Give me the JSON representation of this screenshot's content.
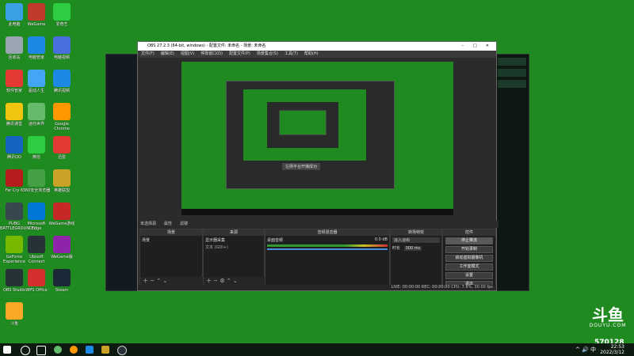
{
  "colors": {
    "desktop_bg": "#1f8a1f",
    "obs_bg": "#2b2b2b",
    "dock_bg": "#1f1f1f"
  },
  "desktop_icons": [
    {
      "label": "此电脑",
      "icon": "computer-icon",
      "color": "#3aa0e6"
    },
    {
      "label": "WeGame",
      "icon": "wegame-icon",
      "color": "#c0392b"
    },
    {
      "label": "爱奇艺",
      "icon": "iqiyi-icon",
      "color": "#2ecc40"
    },
    {
      "label": "回收站",
      "icon": "recycle-bin-icon",
      "color": "#9aa5b1"
    },
    {
      "label": "电脑管家",
      "icon": "pc-manager-icon",
      "color": "#1e88e5"
    },
    {
      "label": "电脑视频",
      "icon": "video-icon",
      "color": "#4a6fdc"
    },
    {
      "label": "软件管家",
      "icon": "software-manager-icon",
      "color": "#e53935"
    },
    {
      "label": "驱动人生",
      "icon": "driver-icon",
      "color": "#42a5f5"
    },
    {
      "label": "腾讯视频",
      "icon": "tencent-video-icon",
      "color": "#1e88e5"
    },
    {
      "label": "腾讯课堂",
      "icon": "notes-icon",
      "color": "#f1c40f"
    },
    {
      "label": "迷你世界",
      "icon": "game-icon",
      "color": "#66bb6a"
    },
    {
      "label": "Google Chrome",
      "icon": "chrome-icon",
      "color": "#ff9800"
    },
    {
      "label": "腾讯QQ",
      "icon": "document-icon",
      "color": "#1565c0"
    },
    {
      "label": "微信",
      "icon": "wechat-icon",
      "color": "#2ecc40"
    },
    {
      "label": "迅雷",
      "icon": "thunder-icon",
      "color": "#e53935"
    },
    {
      "label": "Far Cry 6",
      "icon": "farcry-icon",
      "color": "#b71c1c"
    },
    {
      "label": "360安全浏览器",
      "icon": "browser-360-icon",
      "color": "#43a047"
    },
    {
      "label": "英雄联盟",
      "icon": "lol-icon",
      "color": "#c9a227"
    },
    {
      "label": "PUBG BATTLEGROUNDS",
      "icon": "pubg-icon",
      "color": "#37474f"
    },
    {
      "label": "Microsoft Edge",
      "icon": "edge-icon",
      "color": "#0078d7"
    },
    {
      "label": "WeGame游戏",
      "icon": "wegame2-icon",
      "color": "#c62828"
    },
    {
      "label": "GeForce Experience",
      "icon": "nvidia-icon",
      "color": "#76b900"
    },
    {
      "label": "Ubisoft Connect",
      "icon": "ubisoft-icon",
      "color": "#263238"
    },
    {
      "label": "WeGame版",
      "icon": "wegame3-icon",
      "color": "#8e24aa"
    },
    {
      "label": "OBS Studio",
      "icon": "obs-icon",
      "color": "#263238"
    },
    {
      "label": "WPS Office",
      "icon": "wps-icon",
      "color": "#d32f2f"
    },
    {
      "label": "Steam",
      "icon": "steam-icon",
      "color": "#1b2838"
    },
    {
      "label": "斗鱼",
      "icon": "douyu-icon",
      "color": "#f9a825"
    }
  ],
  "obs": {
    "title": "OBS 27.2.3 (64-bit, windows) - 配置文件: 未命名 - 场景: 未命名",
    "menu": [
      "文件(F)",
      "编辑(E)",
      "视图(V)",
      "停靠窗口(D)",
      "配置文件(P)",
      "场景集合(S)",
      "工具(T)",
      "帮助(H)"
    ],
    "preview_text": "左侧平台开播成功",
    "tabs": [
      "未选择源",
      "属性",
      "滤镜"
    ],
    "docks": {
      "scenes": {
        "header": "场景",
        "item": "场景"
      },
      "sources": {
        "header": "来源",
        "items": [
          "显示器采集",
          "文本 (GDI+)"
        ]
      },
      "mixer": {
        "header": "音频混音器",
        "track": "桌面音频",
        "level": "0.0 dB"
      },
      "transitions": {
        "header": "转场特效",
        "type": "淡入淡出",
        "duration_label": "时长",
        "duration": "300 ms"
      },
      "controls": {
        "header": "控件",
        "buttons": [
          "停止推流",
          "开始录制",
          "启动虚拟摄像机",
          "工作室模式",
          "设置",
          "退出"
        ]
      }
    },
    "status": "LIVE: 00:00:00   REC: 00:00:00   CPU: 7.8%, 30.00 fps"
  },
  "overlay": {
    "logo_mark": "斗鱼",
    "logo_sub": "DOUYU.COM",
    "room_id": "570128"
  },
  "taskbar": {
    "clock_time": "22:53",
    "clock_date": "2022/3/12",
    "tray": "^ 🔊 中"
  }
}
